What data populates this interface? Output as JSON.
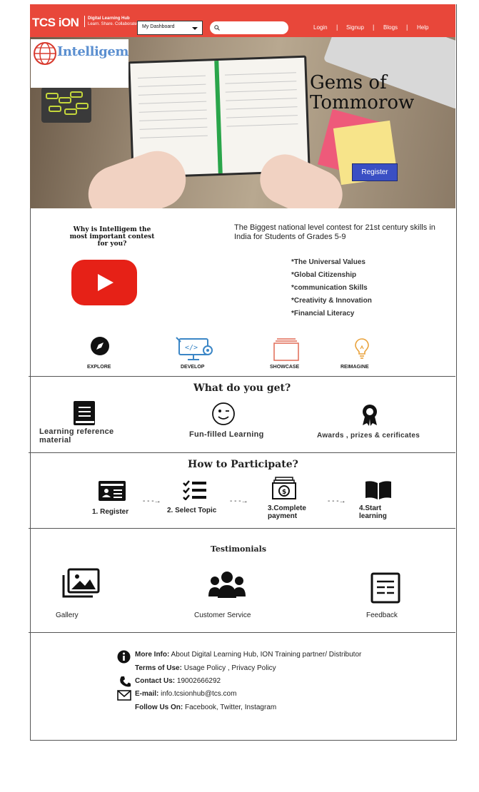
{
  "header": {
    "brand": "TCS iON",
    "brand_sub_1": "Digital Learning Hub",
    "brand_sub_2": "Learn. Share. Collaborate.",
    "dashboard_select": "My Dashboard",
    "search_placeholder": "",
    "links": [
      "Login",
      "Signup",
      "Blogs",
      "Help"
    ],
    "color": "#e8473a"
  },
  "hero": {
    "logo": "Intelligem",
    "headline_1": "Gems of",
    "headline_2": "Tommorow",
    "register_label": "Register",
    "register_color": "#3a4fc4"
  },
  "intro": {
    "why_title": "Why is Intelligem the most important contest for you?",
    "tagline": "The Biggest national level contest for 21st century skills in India for Students of Grades  5-9",
    "skills": [
      "*The Universal Values",
      "*Global Citizenship",
      "*communication Skills",
      "*Creativity & Innovation",
      "*Financial Literacy"
    ]
  },
  "features": {
    "items": [
      {
        "label": "EXPLORE",
        "icon": "compass-icon"
      },
      {
        "label": "DEVELOP",
        "icon": "code-gear-icon"
      },
      {
        "label": "SHOWCASE",
        "icon": "stacked-frames-icon"
      },
      {
        "label": "REIMAGINE",
        "icon": "lightbulb-icon"
      }
    ]
  },
  "benefits": {
    "title": "What do you get?",
    "items": [
      {
        "label": "Learning reference material",
        "icon": "book-icon"
      },
      {
        "label": "Fun-filled Learning",
        "icon": "wink-smiley-icon"
      },
      {
        "label": "Awards , prizes & cerificates",
        "icon": "award-ribbon-icon"
      }
    ]
  },
  "participate": {
    "title": "How to Participate?",
    "steps": [
      {
        "label": "1. Register",
        "icon": "id-card-icon"
      },
      {
        "label": "2. Select Topic",
        "icon": "checklist-icon"
      },
      {
        "label_1": "3.Complete",
        "label_2": "payment",
        "icon": "money-icon"
      },
      {
        "label_1": "4.Start",
        "label_2": "learning",
        "icon": "open-book-icon"
      }
    ],
    "arrow": "- - -→"
  },
  "testimonials": {
    "title": "Testimonials",
    "items": [
      {
        "label": "Gallery",
        "icon": "gallery-icon"
      },
      {
        "label": "Customer Service",
        "icon": "people-group-icon"
      },
      {
        "label": "Feedback",
        "icon": "feedback-form-icon"
      }
    ]
  },
  "footer": {
    "more_info_label": "More Info:",
    "more_info_text": " About Digital Learning Hub, ION Training partner/ Distributor",
    "terms_label": "Terms of Use:",
    "terms_text": " Usage Policy , Privacy Policy",
    "contact_label": "Contact Us:",
    "contact_text": " 19002666292",
    "email_label": "E-mail:",
    "email_text": " info.tcsionhub@tcs.com",
    "follow_label": "Follow Us On:",
    "follow_text": " Facebook, Twitter, Instagram"
  }
}
